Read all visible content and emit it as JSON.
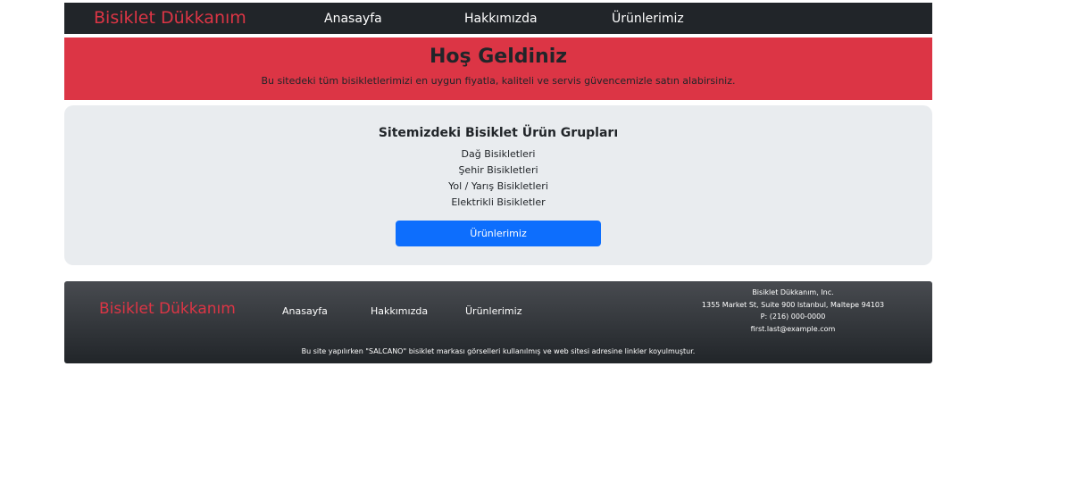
{
  "navbar": {
    "brand": "Bisiklet Dükkanım",
    "links": [
      "Anasayfa",
      "Hakkımızda",
      "Ürünlerimiz"
    ]
  },
  "hero": {
    "title": "Hoş Geldiniz",
    "subtitle": "Bu sitedeki tüm bisikletlerimizi en uygun fiyatla, kaliteli ve servis güvencemizle satın alabirsiniz."
  },
  "groups": {
    "heading": "Sitemizdeki Bisiklet Ürün Grupları",
    "items": [
      "Dağ Bisikletleri",
      "Şehir Bisikletleri",
      "Yol / Yarış Bisikletleri",
      "Elektrikli Bisikletler"
    ],
    "button": "Ürünlerimiz"
  },
  "footer": {
    "brand": "Bisiklet Dükkanım",
    "links": [
      "Anasayfa",
      "Hakkımızda",
      "Ürünlerimiz"
    ],
    "address": {
      "company": "Bisiklet Dükkanım, Inc.",
      "street": "1355 Market St, Suite 900 Istanbul, Maltepe 94103",
      "phone": "P: (216) 000-0000",
      "email": "first.last@example.com"
    },
    "disclaimer": "Bu site yapılırken \"SALCANO\" bisiklet markası görselleri kullanılmış ve web sitesi adresine linkler koyulmuştur."
  },
  "colors": {
    "brand": "#dc3545",
    "navbar_bg": "#212529",
    "hero_bg": "#dc3545",
    "panel_bg": "#e9ecef",
    "button_bg": "#0d6efd"
  }
}
